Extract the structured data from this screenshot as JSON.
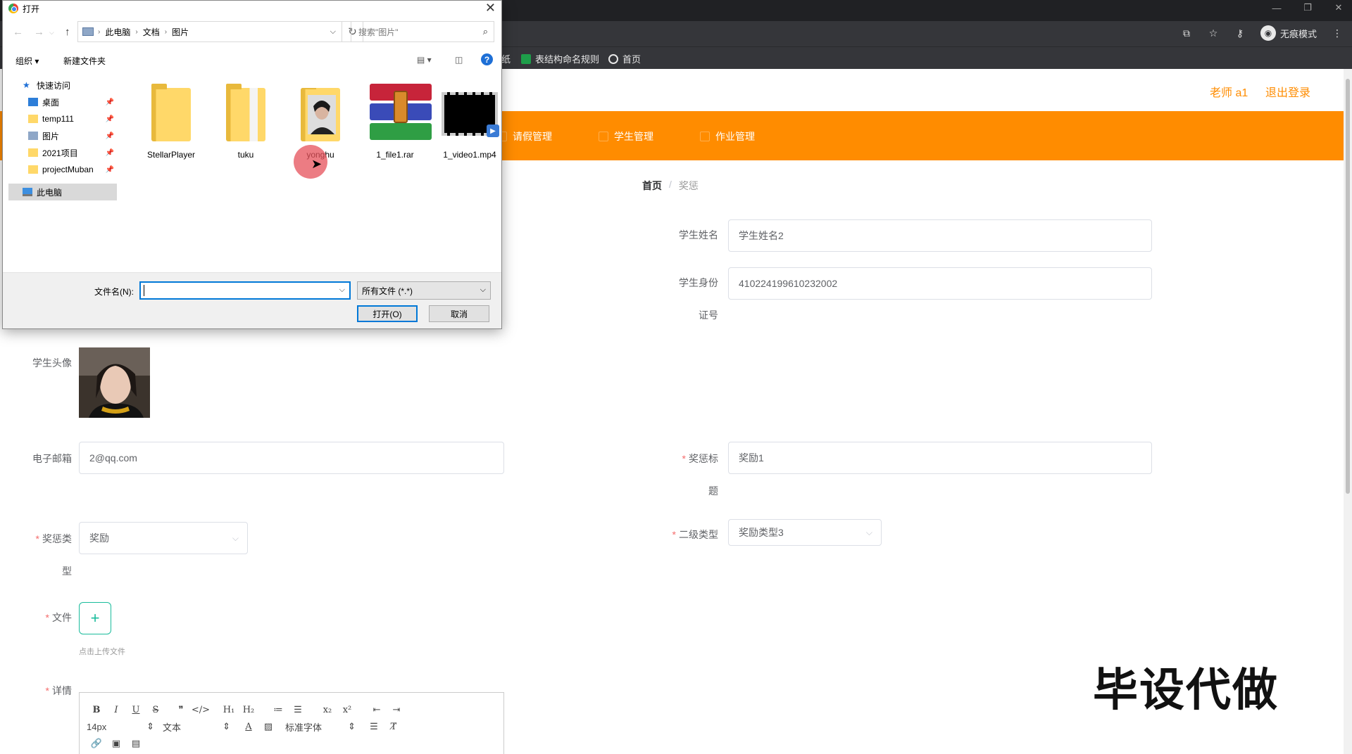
{
  "browser": {
    "window_controls": [
      "—",
      "❐",
      "✕"
    ],
    "incognito_label": "无痕模式",
    "bookmarks": [
      {
        "label": "纸",
        "icon": "bookmark-icon"
      },
      {
        "label": "表结构命名规则",
        "icon": "sheet-icon"
      },
      {
        "label": "首页",
        "icon": "globe-icon"
      }
    ]
  },
  "header": {
    "user": "老师 a1",
    "logout": "退出登录",
    "accent": "#ff8c00"
  },
  "nav": {
    "items": [
      "请假管理",
      "学生管理",
      "作业管理"
    ]
  },
  "breadcrumb": {
    "home": "首页",
    "separator": "/",
    "current": "奖惩"
  },
  "form": {
    "student_name_label": "学生姓名",
    "student_name_value": "学生姓名2",
    "id_label_1": "学生身份",
    "id_label_2": "证号",
    "id_value": "410224199610232002",
    "avatar_label": "学生头像",
    "email_label": "电子邮箱",
    "email_value": "2@qq.com",
    "title_label_1": "奖惩标",
    "title_label_2": "题",
    "title_value": "奖励1",
    "type_label_1": "奖惩类",
    "type_label_2": "型",
    "type_value": "奖励",
    "subtype_label": "二级类型",
    "subtype_value": "奖励类型3",
    "file_label": "文件",
    "upload_plus": "+",
    "upload_tip": "点击上传文件",
    "detail_label": "详情",
    "required_mark": "*"
  },
  "editor": {
    "row1": [
      "B",
      "I",
      "U",
      "S",
      "❞",
      "</>",
      "H₁",
      "H₂",
      "≔",
      "☰",
      "x₂",
      "x²",
      "⇤",
      "⇥"
    ],
    "size": "14px",
    "format": "文本",
    "font": "标准字体",
    "row3": [
      "🔗",
      "▣",
      "▤"
    ]
  },
  "watermark": "毕设代做",
  "dialog": {
    "title": "打开",
    "path": [
      "此电脑",
      "文档",
      "图片"
    ],
    "search_placeholder": "搜索\"图片\"",
    "organize": "组织 ▾",
    "new_folder": "新建文件夹",
    "help": "?",
    "tree": [
      {
        "label": "快速访问",
        "icon": "star-icon",
        "pinned": false
      },
      {
        "label": "桌面",
        "icon": "desktop-icon",
        "pinned": true
      },
      {
        "label": "temp111",
        "icon": "folder-icon",
        "pinned": true
      },
      {
        "label": "图片",
        "icon": "pictures-icon",
        "pinned": true
      },
      {
        "label": "2021项目",
        "icon": "folder-icon",
        "pinned": true
      },
      {
        "label": "projectMuban",
        "icon": "folder-icon",
        "pinned": true
      },
      {
        "label": "此电脑",
        "icon": "computer-icon",
        "pinned": false
      }
    ],
    "files": [
      {
        "name": "StellarPlayer",
        "kind": "folder"
      },
      {
        "name": "tuku",
        "kind": "folder"
      },
      {
        "name": "yonghu",
        "kind": "folder-photo"
      },
      {
        "name": "1_file1.rar",
        "kind": "rar"
      },
      {
        "name": "1_video1.mp4",
        "kind": "video"
      }
    ],
    "filename_label": "文件名(N):",
    "filename_value": "",
    "filetype": "所有文件 (*.*)",
    "open_button": "打开(O)",
    "cancel_button": "取消"
  }
}
